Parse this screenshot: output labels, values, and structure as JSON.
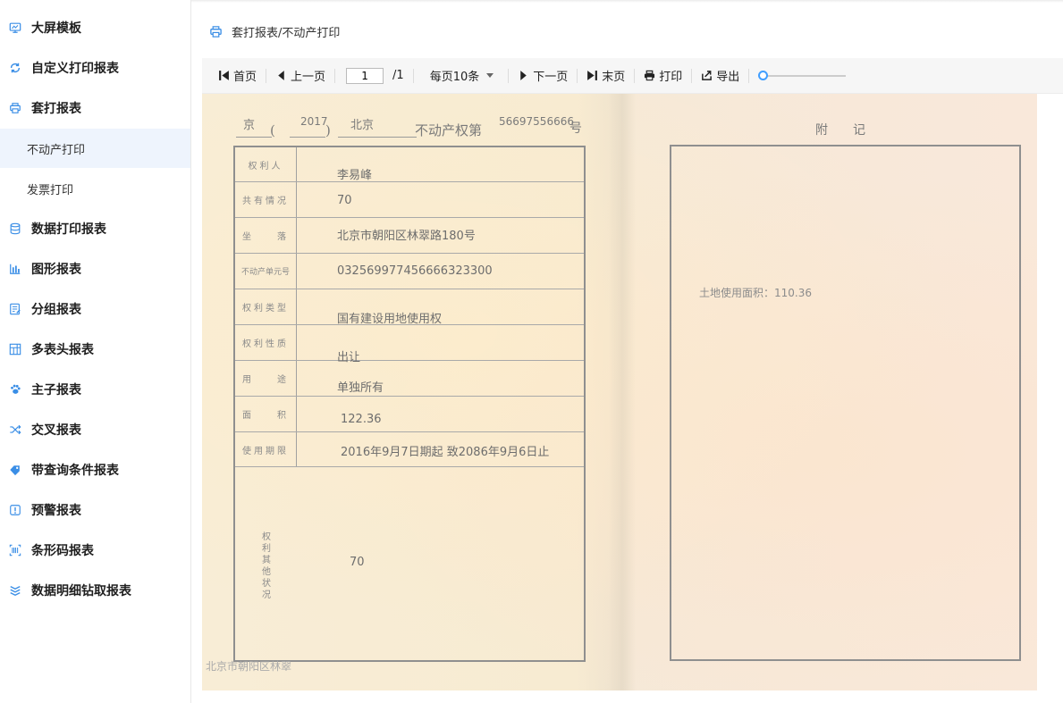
{
  "sidebar": {
    "items": [
      {
        "label": "大屏模板",
        "icon": "monitor-icon"
      },
      {
        "label": "自定义打印报表",
        "icon": "refresh-icon"
      },
      {
        "label": "套打报表",
        "icon": "printer-icon"
      },
      {
        "label": "不动产打印",
        "sub": true,
        "active": true
      },
      {
        "label": "发票打印",
        "sub": true
      },
      {
        "label": "数据打印报表",
        "icon": "database-icon"
      },
      {
        "label": "图形报表",
        "icon": "bar-chart-icon"
      },
      {
        "label": "分组报表",
        "icon": "edit-list-icon"
      },
      {
        "label": "多表头报表",
        "icon": "table-header-icon"
      },
      {
        "label": "主子报表",
        "icon": "paw-icon"
      },
      {
        "label": "交叉报表",
        "icon": "shuffle-icon"
      },
      {
        "label": "带查询条件报表",
        "icon": "tag-icon"
      },
      {
        "label": "预警报表",
        "icon": "alert-icon"
      },
      {
        "label": "条形码报表",
        "icon": "barcode-icon"
      },
      {
        "label": "数据明细钻取报表",
        "icon": "layers-icon"
      }
    ]
  },
  "breadcrumb": "套打报表/不动产打印",
  "toolbar": {
    "first": "首页",
    "prev": "上一页",
    "page_value": "1",
    "page_total": "/1",
    "page_size": "每页10条",
    "next": "下一页",
    "last": "末页",
    "print": "打印",
    "export": "导出",
    "zoom_level": 0
  },
  "certificate": {
    "header": {
      "jing": "京",
      "lparen": "(",
      "year": "2017",
      "rparen": ")",
      "city": "北京",
      "title": "不动产权第",
      "number": "56697556666",
      "hao": "号",
      "right_title": "附　　记"
    },
    "rows": [
      {
        "label": "权利人",
        "value": "李易峰"
      },
      {
        "label": "共有情况",
        "value": "70"
      },
      {
        "label": "坐　　落",
        "value": "北京市朝阳区林翠路180号"
      },
      {
        "label": "不动产单元号",
        "value": "032569977456666323300"
      },
      {
        "label": "权利类型",
        "value": "国有建设用地使用权"
      },
      {
        "label": "权利性质",
        "value": "出让"
      },
      {
        "label": "用　　途",
        "value": "单独所有"
      },
      {
        "label": "面　　积",
        "value": "122.36"
      },
      {
        "label": "使用期限",
        "value": "2016年9月7日期起 致2086年9月6日止"
      }
    ],
    "other_label": "权利其他状况",
    "other_value": "70",
    "note": "土地使用面积：110.36",
    "footer": "北京市朝阳区林翠"
  }
}
